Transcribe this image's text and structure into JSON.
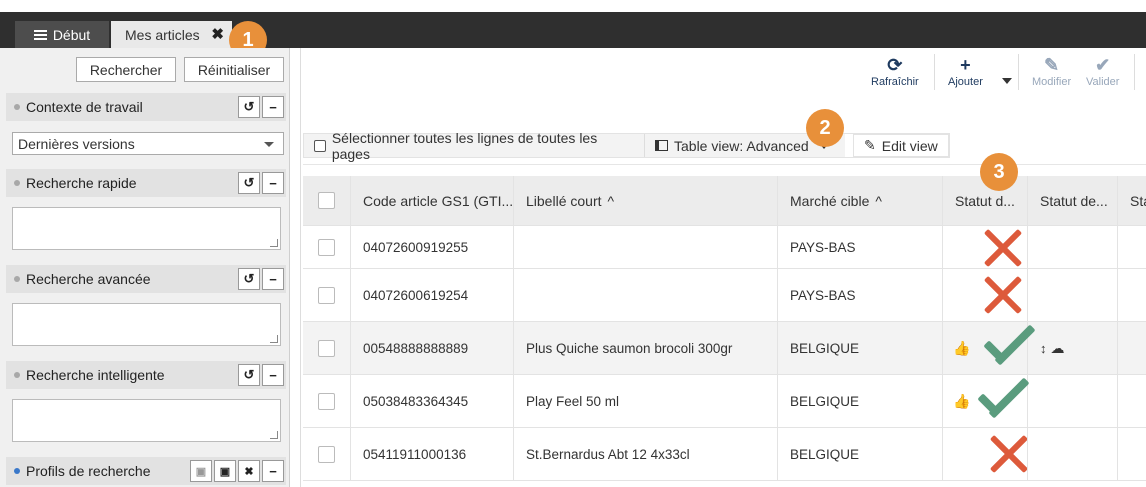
{
  "tabs": {
    "home_label": "Début",
    "articles_label": "Mes articles",
    "close_glyph": "✖"
  },
  "badges": [
    "1",
    "2",
    "3"
  ],
  "left": {
    "search_label": "Rechercher",
    "reset_label": "Réinitialiser",
    "sections": {
      "context": "Contexte de travail",
      "quick": "Recherche rapide",
      "advanced": "Recherche avancée",
      "smart": "Recherche intelligente",
      "profiles": "Profils de recherche"
    },
    "context_value": "Dernières versions"
  },
  "toolbar": {
    "refresh": "Rafraîchir",
    "add": "Ajouter",
    "edit": "Modifier",
    "validate": "Valider"
  },
  "viewbar": {
    "select_all": "Sélectionner toutes les lignes de toutes les pages",
    "table_view": "Table view: Advanced",
    "edit_view": "Edit view"
  },
  "table": {
    "columns": [
      "Code article GS1 (GTI...",
      "Libellé court",
      "Marché cible",
      "Statut d...",
      "Statut de...",
      "Sta"
    ],
    "rows": [
      {
        "code": "04072600919255",
        "label": "",
        "market": "PAYS-BAS",
        "status": "rejected"
      },
      {
        "code": "04072600619254",
        "label": "",
        "market": "PAYS-BAS",
        "status": "rejected"
      },
      {
        "code": "00548888888889",
        "label": "Plus Quiche saumon brocoli 300gr",
        "market": "BELGIQUE",
        "status": "approved"
      },
      {
        "code": "05038483364345",
        "label": "Play Feel 50 ml",
        "market": "BELGIQUE",
        "status": "approved"
      },
      {
        "code": "05411911000136",
        "label": "St.Bernardus Abt 12 4x33cl",
        "market": "BELGIQUE",
        "status": "rejected"
      }
    ]
  },
  "colors": {
    "badge": "#e8903a",
    "reject": "#dd5a3b",
    "approve": "#5a9c7e",
    "tabbar": "#2f2f2f"
  }
}
